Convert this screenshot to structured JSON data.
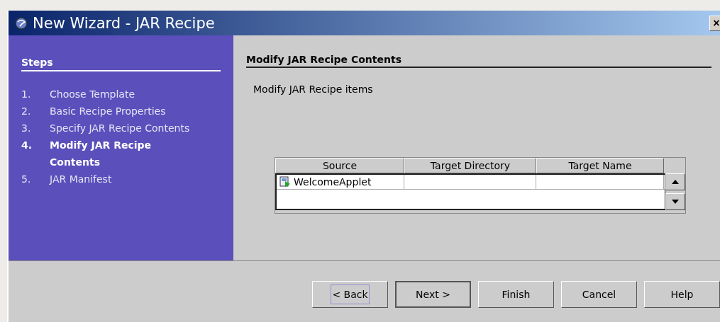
{
  "window": {
    "title": "New Wizard - JAR Recipe",
    "close": "×"
  },
  "steps": {
    "title": "Steps",
    "items": [
      {
        "number": "1.",
        "label": "Choose Template",
        "selected": false
      },
      {
        "number": "2.",
        "label": "Basic Recipe Properties",
        "selected": false
      },
      {
        "number": "3.",
        "label": "Specify JAR Recipe Contents",
        "selected": false
      },
      {
        "number": "4.",
        "label": "Modify JAR Recipe Contents",
        "selected": true
      },
      {
        "number": "5.",
        "label": "JAR Manifest",
        "selected": false
      }
    ]
  },
  "panel": {
    "title": "Modify JAR Recipe Contents",
    "description": "Modify JAR Recipe items"
  },
  "table": {
    "columns": [
      "Source",
      "Target Directory",
      "Target Name"
    ],
    "rows": [
      [
        "WelcomeApplet",
        "",
        ""
      ]
    ]
  },
  "buttons": [
    {
      "label": "< Back",
      "focused": true,
      "default": false
    },
    {
      "label": "Next >",
      "focused": false,
      "default": true
    },
    {
      "label": "Finish",
      "focused": false,
      "default": false
    },
    {
      "label": "Cancel",
      "focused": false,
      "default": false
    },
    {
      "label": "Help",
      "focused": false,
      "default": false
    }
  ]
}
